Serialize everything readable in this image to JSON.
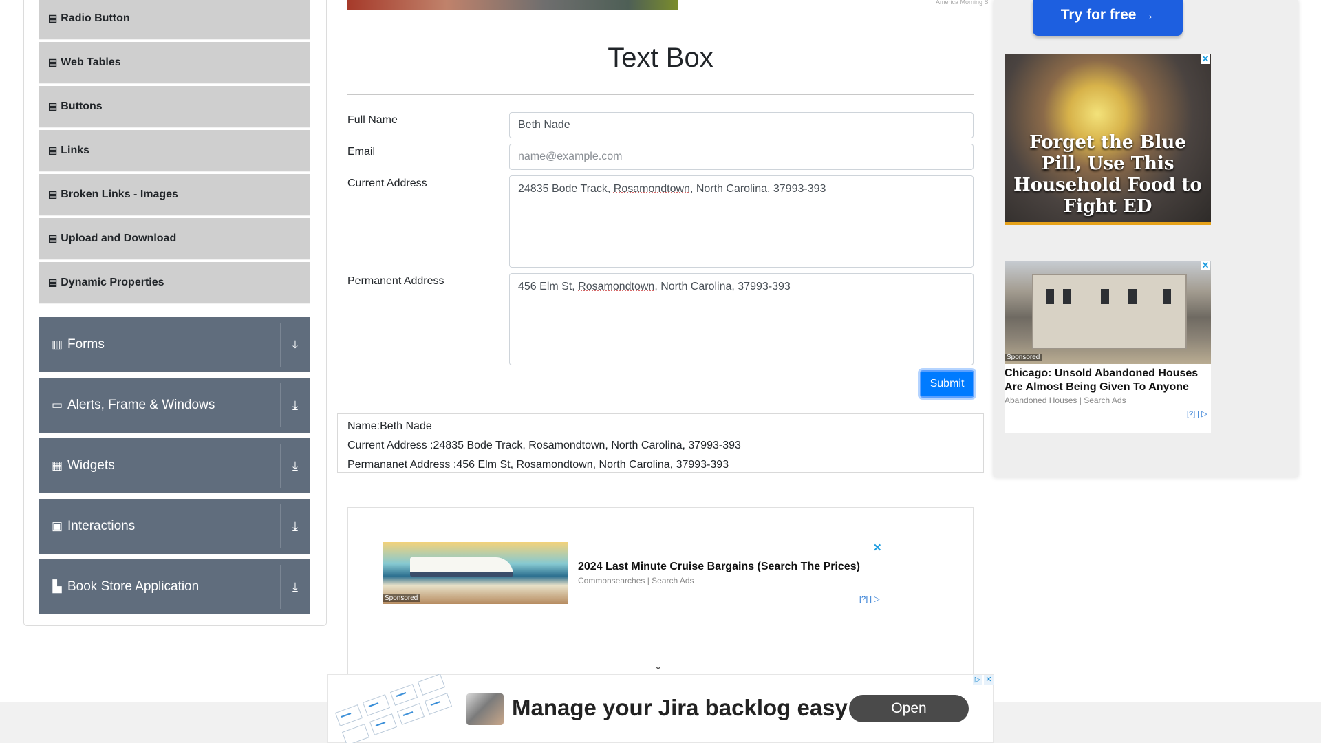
{
  "sidebar": {
    "sub_items": [
      {
        "label": "Radio Button",
        "icon": "file-icon"
      },
      {
        "label": "Web Tables",
        "icon": "file-icon"
      },
      {
        "label": "Buttons",
        "icon": "file-icon"
      },
      {
        "label": "Links",
        "icon": "file-icon"
      },
      {
        "label": "Broken Links - Images",
        "icon": "file-icon"
      },
      {
        "label": "Upload and Download",
        "icon": "file-icon"
      },
      {
        "label": "Dynamic Properties",
        "icon": "file-icon"
      }
    ],
    "groups": [
      {
        "label": "Forms",
        "icon": "form-icon"
      },
      {
        "label": "Alerts, Frame & Windows",
        "icon": "window-icon"
      },
      {
        "label": "Widgets",
        "icon": "widgets-icon"
      },
      {
        "label": "Interactions",
        "icon": "interactions-icon"
      },
      {
        "label": "Book Store Application",
        "icon": "bookstore-icon"
      }
    ]
  },
  "main": {
    "title": "Text Box",
    "micro_text": "America Morning S",
    "form": {
      "full_name_label": "Full Name",
      "full_name_value": "Beth Nade",
      "email_label": "Email",
      "email_placeholder": "name@example.com",
      "current_address_label": "Current Address",
      "current_address_pre": "24835 Bode Track, ",
      "current_address_city": "Rosamondtown",
      "current_address_post": ", North Carolina, 37993-393",
      "permanent_address_label": "Permanent Address",
      "permanent_address_pre": "456 Elm St, ",
      "permanent_address_city": "Rosamondtown",
      "permanent_address_post": ", North Carolina, 37993-393",
      "submit_label": "Submit"
    },
    "output": {
      "name": "Name:Beth Nade",
      "current_address": "Current Address :24835 Bode Track, Rosamondtown, North Carolina, 37993-393",
      "permanent_address": "Permananet Address :456 Elm St, Rosamondtown, North Carolina, 37993-393"
    }
  },
  "ads": {
    "try_free": "Try for free →",
    "ad1_headline": "Forget the Blue Pill, Use This Household Food to Fight ED",
    "ad2_sponsored": "Sponsored",
    "ad2_headline": "Chicago: Unsold Abandoned Houses Are Almost Being Given To Anyone",
    "ad2_source": "Abandoned Houses | Search Ads",
    "ad_info": "[?] |",
    "cruise_sponsored": "Sponsored",
    "cruise_headline": "2024 Last Minute Cruise Bargains (Search The Prices)",
    "cruise_source": "Commonsearches | Search Ads",
    "close_glyph": "✕",
    "banner_text": "Manage your Jira backlog easy",
    "banner_button": "Open"
  },
  "colors": {
    "accent": "#007bff",
    "nav_group_bg": "#606d7d",
    "nav_item_bg": "#cfcfcf"
  }
}
